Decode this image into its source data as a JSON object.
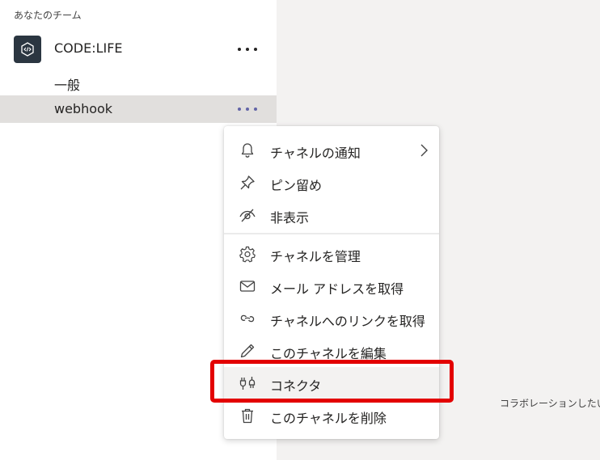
{
  "sidebar": {
    "heading": "あなたのチーム",
    "team": {
      "name": "CODE:LIFE",
      "avatar_icon": "code-brackets-icon"
    },
    "channels": [
      {
        "label": "一般"
      },
      {
        "label": "webhook"
      }
    ]
  },
  "menu": {
    "items": [
      {
        "label": "チャネルの通知",
        "icon": "bell-icon"
      },
      {
        "label": "ピン留め",
        "icon": "pin-icon"
      },
      {
        "label": "非表示",
        "icon": "eye-off-icon"
      },
      {
        "label": "チャネルを管理",
        "icon": "gear-icon"
      },
      {
        "label": "メール アドレスを取得",
        "icon": "mail-icon"
      },
      {
        "label": "チャネルへのリンクを取得",
        "icon": "link-icon"
      },
      {
        "label": "このチャネルを編集",
        "icon": "pencil-icon"
      },
      {
        "label": "コネクタ",
        "icon": "connector-plug-icon"
      },
      {
        "label": "このチャネルを削除",
        "icon": "trash-icon"
      }
    ]
  },
  "main": {
    "footer_text": "コラボレーションしたい"
  },
  "colors": {
    "accent": "#6264a7",
    "highlight_border": "#e30000",
    "avatar_bg": "#2b3641"
  }
}
